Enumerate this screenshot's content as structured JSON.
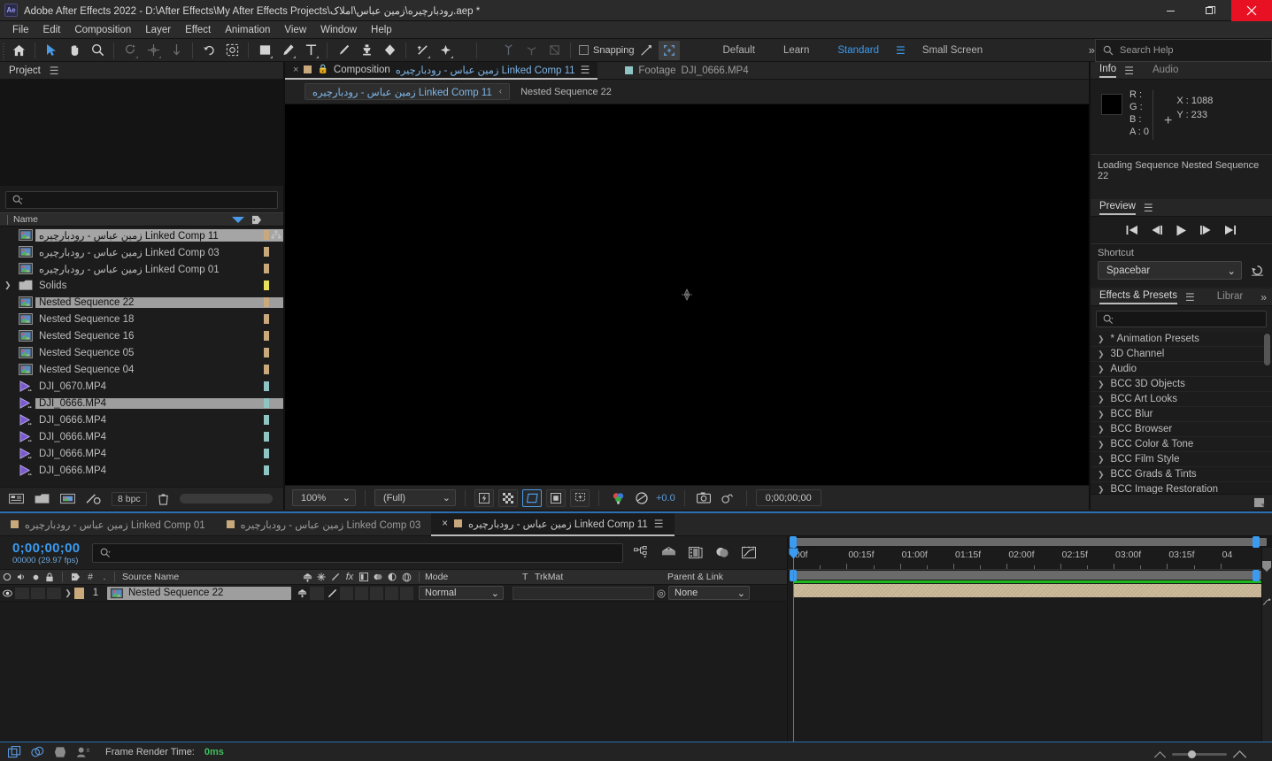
{
  "window": {
    "title": "Adobe After Effects 2022 - D:\\After Effects\\My After Effects Projects\\رودبارچیره\\زمین عباس\\املاک.aep *",
    "logo": "ae-logo",
    "minimize": "−",
    "maximize": "❐",
    "close": "✕"
  },
  "menubar": {
    "items": [
      "File",
      "Edit",
      "Composition",
      "Layer",
      "Effect",
      "Animation",
      "View",
      "Window",
      "Help"
    ]
  },
  "toolbar": {
    "snapping_label": "Snapping",
    "workspaces": [
      "Default",
      "Learn",
      "Standard",
      "Small Screen"
    ],
    "active_workspace": "Standard",
    "overflow": "»",
    "search_placeholder": "Search Help"
  },
  "project": {
    "title": "Project",
    "search_placeholder": "",
    "column_name": "Name",
    "bit_depth": "8 bpc",
    "items": [
      {
        "label": "زمین عباس - رودبارچیره Linked Comp 11",
        "type": "comp",
        "color": "#c9a87c",
        "selected": true,
        "shared": true
      },
      {
        "label": "زمین عباس - رودبارچیره Linked Comp 03",
        "type": "comp",
        "color": "#c9a87c"
      },
      {
        "label": "زمین عباس - رودبارچیره Linked Comp 01",
        "type": "comp",
        "color": "#c9a87c"
      },
      {
        "label": "Solids",
        "type": "folder",
        "color": "#e8e05a",
        "expandable": true
      },
      {
        "label": "Nested Sequence 22",
        "type": "comp",
        "color": "#c9a87c",
        "highlighted": true
      },
      {
        "label": "Nested Sequence 18",
        "type": "comp",
        "color": "#c9a87c"
      },
      {
        "label": "Nested Sequence 16",
        "type": "comp",
        "color": "#c9a87c"
      },
      {
        "label": "Nested Sequence 05",
        "type": "comp",
        "color": "#c9a87c"
      },
      {
        "label": "Nested Sequence 04",
        "type": "comp",
        "color": "#c9a87c"
      },
      {
        "label": "DJI_0670.MP4",
        "type": "video",
        "color": "#8fc4c4"
      },
      {
        "label": "DJI_0666.MP4",
        "type": "video",
        "color": "#8fc4c4",
        "highlighted": true
      },
      {
        "label": "DJI_0666.MP4",
        "type": "video",
        "color": "#8fc4c4"
      },
      {
        "label": "DJI_0666.MP4",
        "type": "video",
        "color": "#8fc4c4"
      },
      {
        "label": "DJI_0666.MP4",
        "type": "video",
        "color": "#8fc4c4"
      },
      {
        "label": "DJI_0666.MP4",
        "type": "video",
        "color": "#8fc4c4"
      }
    ]
  },
  "viewer": {
    "tab_close": "×",
    "tab_kind": "Composition",
    "tab_comp_name": "زمین عباس - رودبارچیره Linked Comp 11",
    "tab2_kind": "Footage",
    "tab2_name": "DJI_0666.MP4",
    "breadcrumb_comp": "زمین عباس - رودبارچیره Linked Comp 11",
    "breadcrumb_arrow": "‹",
    "breadcrumb_child": "Nested Sequence 22",
    "zoom": "100%",
    "resolution": "(Full)",
    "exposure": "+0.0",
    "timecode": "0;00;00;00"
  },
  "info": {
    "tab": "Info",
    "tab2": "Audio",
    "r_label": "R :",
    "g_label": "G :",
    "b_label": "B :",
    "a_label": "A :",
    "a_value": "0",
    "x_label": "X : 1088",
    "y_label": "Y : 233",
    "status": "Loading Sequence Nested Sequence 22"
  },
  "preview": {
    "title": "Preview",
    "shortcut_label": "Shortcut",
    "shortcut_value": "Spacebar",
    "transport": [
      "first-frame",
      "prev-frame",
      "play",
      "next-frame",
      "last-frame"
    ]
  },
  "effects": {
    "tab": "Effects & Presets",
    "tab2": "Librar",
    "search_placeholder": "",
    "categories": [
      "* Animation Presets",
      "3D Channel",
      "Audio",
      "BCC 3D Objects",
      "BCC Art Looks",
      "BCC Blur",
      "BCC Browser",
      "BCC Color & Tone",
      "BCC Film Style",
      "BCC Grads & Tints",
      "BCC Image Restoration"
    ]
  },
  "timeline": {
    "tabs": [
      {
        "label": "زمین عباس - رودبارچیره Linked Comp 01",
        "active": false
      },
      {
        "label": "زمین عباس - رودبارچیره Linked Comp 03",
        "active": false
      },
      {
        "label": "زمین عباس - رودبارچیره Linked Comp 11",
        "active": true,
        "closable": true
      }
    ],
    "timecode": "0;00;00;00",
    "frame_info": "00000 (29.97 fps)",
    "search_placeholder": "",
    "columns": {
      "source_name": "Source Name",
      "mode": "Mode",
      "t": "T",
      "trkmat": "TrkMat",
      "parent_link": "Parent & Link",
      "index": "#"
    },
    "layers": [
      {
        "index": "1",
        "name": "Nested Sequence 22",
        "mode": "Normal",
        "parent": "None",
        "label_color": "#c9a87c",
        "visible": true
      }
    ],
    "ruler_ticks": [
      "00f",
      "00:15f",
      "01:00f",
      "01:15f",
      "02:00f",
      "02:15f",
      "03:00f",
      "03:15f",
      "04"
    ]
  },
  "status_bar": {
    "render_label": "Frame Render Time:",
    "render_value": "0ms"
  },
  "colors": {
    "accent_blue": "#3b9bf0",
    "comp_label": "#c9a87c",
    "video_label": "#8fc4c4",
    "solid_label": "#e8e05a",
    "green_render": "#1db81d",
    "close_red": "#e81123"
  }
}
